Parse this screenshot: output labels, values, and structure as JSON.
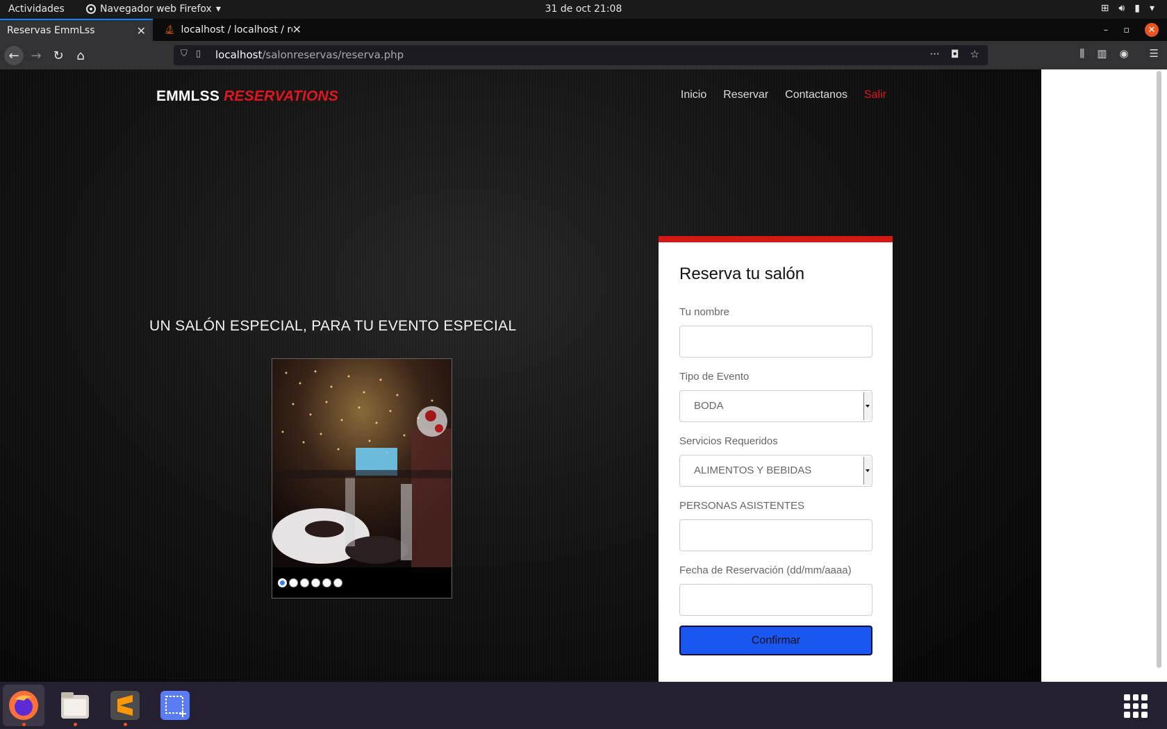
{
  "system_bar": {
    "activities": "Actividades",
    "app_menu": "Navegador web Firefox",
    "clock": "31 de oct  21:08"
  },
  "browser": {
    "tabs": [
      {
        "title": "Reservas EmmLss",
        "active": true
      },
      {
        "title": "localhost / localhost / re",
        "active": false
      }
    ],
    "url_host": "localhost",
    "url_path": "/salonreservas/reserva.php"
  },
  "site": {
    "brand_white": "EMMLSS",
    "brand_red": "RESERVATIONS",
    "nav": [
      "Inicio",
      "Reservar",
      "Contactanos",
      "Salir"
    ],
    "tagline": "UN SALÓN ESPECIAL, PARA TU EVENTO ESPECIAL",
    "carousel": {
      "slides": 6,
      "active": 1
    }
  },
  "form": {
    "title": "Reserva tu salón",
    "name_label": "Tu nombre",
    "event_label": "Tipo de Evento",
    "event_value": "BODA",
    "services_label": "Servicios Requeridos",
    "services_value": "ALIMENTOS Y BEBIDAS",
    "guests_label": "PERSONAS ASISTENTES",
    "date_label": "Fecha de Reservación (dd/mm/aaaa)",
    "submit": "Confirmar"
  },
  "colors": {
    "accent_red": "#e3151e",
    "button_blue": "#1a56f0"
  }
}
